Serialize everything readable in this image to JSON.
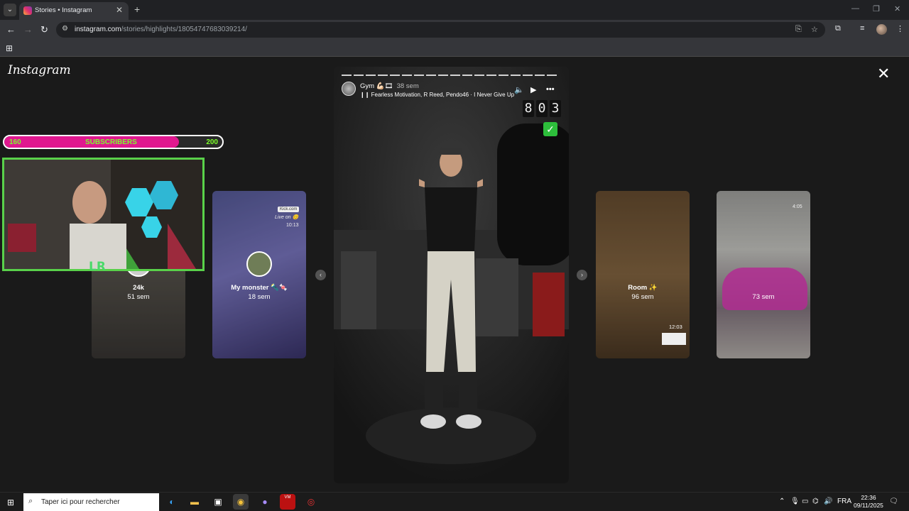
{
  "browser": {
    "tab_title": "Stories • Instagram",
    "url_host": "instagram.com",
    "url_path": "/stories/highlights/18054747683039214/"
  },
  "instagram": {
    "logo": "Instagram"
  },
  "stream_overlay": {
    "sub_current": "160",
    "sub_label": "SUBSCRIBERS",
    "sub_goal": "200",
    "sub_progress_fraction": 0.8
  },
  "thumbnails": [
    {
      "title": "24k",
      "meta": "51 sem"
    },
    {
      "title": "My monster 🔦🍬",
      "meta": "18 sem",
      "label_kick": "Kick.com",
      "label_live": "Live on 😊",
      "label_time": "10:13"
    },
    {
      "title": "Room ✨",
      "meta": "96 sem",
      "label_time": "12:03"
    },
    {
      "title": "",
      "meta": "73 sem",
      "label_time": "4:05"
    }
  ],
  "story": {
    "username": "Gym 💪🏻🎞",
    "time": "38 sem",
    "music": "Fearless Motivation, R Reed, Pendo46 · I Never Give Up",
    "counter": [
      "8",
      "0",
      "3"
    ],
    "check": "✓"
  },
  "taskbar": {
    "search_placeholder": "Taper ici pour rechercher",
    "lang": "FRA",
    "time": "22:36",
    "date": "09/11/2025"
  }
}
